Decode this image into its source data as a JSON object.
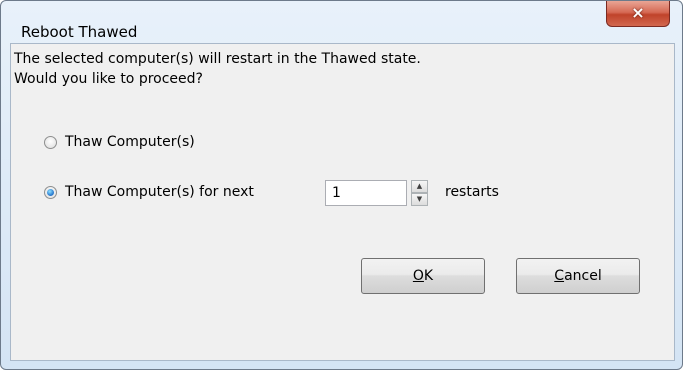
{
  "dialog": {
    "title": "Reboot Thawed",
    "close_icon": "×"
  },
  "message": {
    "line1": "The selected computer(s) will restart in the Thawed state.",
    "line2": "Would you like to proceed?"
  },
  "options": [
    {
      "label": "Thaw Computer(s)",
      "selected": false
    },
    {
      "label": "Thaw Computer(s) for next",
      "selected": true
    }
  ],
  "restarts": {
    "value": "1",
    "suffix": "restarts"
  },
  "buttons": {
    "ok_mnemonic": "O",
    "ok_rest": "K",
    "cancel_mnemonic": "C",
    "cancel_rest": "ancel"
  },
  "icons": {
    "spin_up": "▲",
    "spin_down": "▼"
  }
}
